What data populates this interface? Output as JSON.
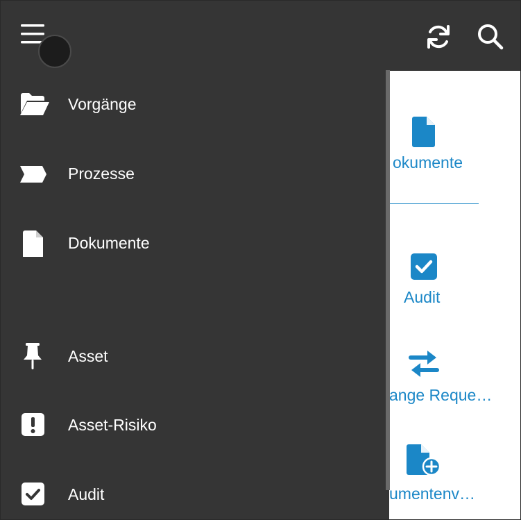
{
  "drawer": {
    "items": [
      {
        "label": "Vorgänge",
        "icon": "folder-open-icon"
      },
      {
        "label": "Prozesse",
        "icon": "chevron-flag-icon"
      },
      {
        "label": "Dokumente",
        "icon": "file-icon"
      },
      {
        "label": "Asset",
        "icon": "pushpin-icon"
      },
      {
        "label": "Asset-Risiko",
        "icon": "exclamation-square-icon"
      },
      {
        "label": "Audit",
        "icon": "check-square-icon"
      }
    ]
  },
  "topbar": {
    "menu_icon": "hamburger-menu-icon",
    "sync_icon": "sync-icon",
    "search_icon": "search-icon"
  },
  "content": {
    "tiles": [
      {
        "label": "okumente",
        "icon": "file-icon"
      },
      {
        "label": "Audit",
        "icon": "check-square-icon"
      },
      {
        "label": "ange Reque…",
        "icon": "exchange-arrows-icon"
      },
      {
        "label": "umentenv…",
        "icon": "file-plus-icon"
      }
    ]
  },
  "colors": {
    "drawer_bg": "#353535",
    "accent": "#1b87c7",
    "text_light": "#ffffff"
  }
}
